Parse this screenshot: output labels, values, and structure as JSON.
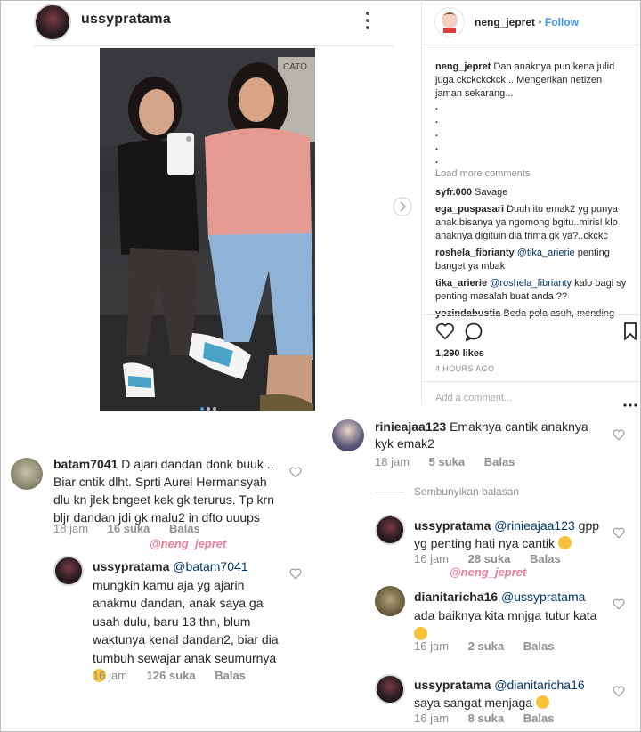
{
  "post_header": {
    "username": "ussypratama"
  },
  "right_panel": {
    "username": "neng_jepret",
    "follow_label": "Follow",
    "caption_user": "neng_jepret",
    "caption_text": "Dan anaknya pun kena julid juga ckckckckck... Mengerikan netizen jaman sekarang...",
    "dots": [
      ".",
      ".",
      ".",
      ".",
      "."
    ],
    "load_more": "Load more comments",
    "comments": [
      {
        "user": "syfr.000",
        "text": "Savage"
      },
      {
        "user": "ega_puspasari",
        "text": "Duuh itu emak2 yg punya anak,bisanya ya ngomong bgitu..miris! klo anaknya digituin dia trima gk ya?..ckckc"
      },
      {
        "user": "roshela_fibrianty",
        "mention": "@tika_arierie",
        "text": "penting banget ya mbak"
      },
      {
        "user": "tika_arierie",
        "mention": "@roshela_fibrianty",
        "text": "kalo bagi sy penting masalah buat anda ??"
      },
      {
        "user": "yozindabustia",
        "text": "Beda pola asuh, mending"
      }
    ],
    "likes": "1,290 likes",
    "time": "4 HOURS AGO",
    "add_comment_placeholder": "Add a comment..."
  },
  "left_comments": {
    "batam": {
      "user": "batam7041",
      "lines": [
        "D ajari dandan donk buuk ..",
        "Biar cntik dlht. Sprti Aurel Hermansyah",
        "dlu kn jlek bngeet kek gk terurus. Tp krn",
        "bljr dandan jdi gk malu2 in dfto uuups"
      ],
      "time": "18 jam",
      "likes": "16 suka",
      "reply": "Balas"
    },
    "watermark": "@neng_jepret",
    "ussy_reply": {
      "user": "ussypratama",
      "mention": "@batam7041",
      "lines": [
        "mungkin kamu aja yg ajarin",
        "anakmu dandan, anak saya ga",
        "usah dulu, baru 13 thn, blum",
        "waktunya kenal dandan2, biar dia",
        "tumbuh sewajar anak seumurnya"
      ],
      "time": "16 jam",
      "likes": "126 suka",
      "reply": "Balas"
    }
  },
  "right_comments": {
    "rinie": {
      "user": "rinieajaa123",
      "text": "Emaknya cantik anaknya",
      "text2": "kyk emak2",
      "time": "18 jam",
      "likes": "5 suka",
      "reply": "Balas"
    },
    "hide_replies": "Sembunyikan balasan",
    "ussy1": {
      "user": "ussypratama",
      "mention": "@rinieajaa123",
      "text": "gpp",
      "text2": "yg penting hati nya cantik",
      "time": "16 jam",
      "likes": "28 suka",
      "reply": "Balas"
    },
    "watermark": "@neng_jepret",
    "diani": {
      "user": "dianitaricha16",
      "mention": "@ussypratama",
      "text2": "ada baiknya kita mnjga tutur kata",
      "time": "16 jam",
      "likes": "2 suka",
      "reply": "Balas"
    },
    "ussy2": {
      "user": "ussypratama",
      "mention": "@dianitaricha16",
      "text2": "saya sangat menjaga",
      "time": "16 jam",
      "likes": "8 suka",
      "reply": "Balas"
    }
  },
  "photo_text": {
    "sign": "CATO"
  },
  "colors": {
    "link": "#003569",
    "follow": "#3897f0",
    "meta": "#8e8e8e"
  }
}
